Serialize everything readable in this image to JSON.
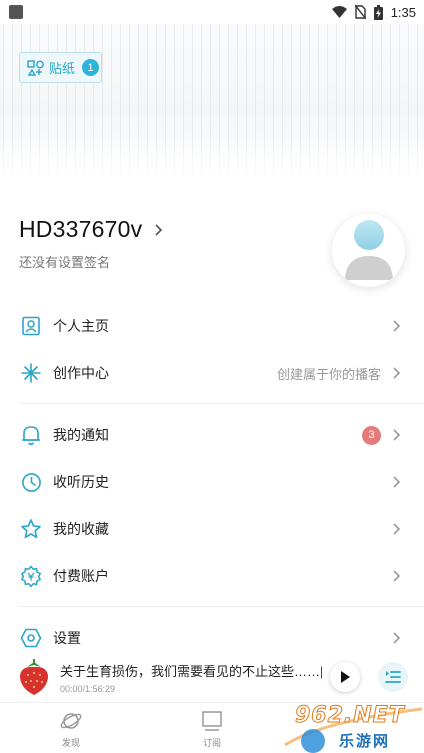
{
  "status_bar": {
    "time": "1:35"
  },
  "sticker": {
    "label": "贴纸",
    "count": "1"
  },
  "user": {
    "name": "HD337670v",
    "signature": "还没有设置签名"
  },
  "menu": {
    "profile": {
      "label": "个人主页"
    },
    "creator": {
      "label": "创作中心",
      "hint": "创建属于你的播客"
    },
    "notifications": {
      "label": "我的通知",
      "badge": "3"
    },
    "history": {
      "label": "收听历史"
    },
    "favorites": {
      "label": "我的收藏"
    },
    "paid": {
      "label": "付费账户"
    },
    "settings": {
      "label": "设置"
    }
  },
  "player": {
    "title": "关于生育损伤，我们需要看见的不止这些……|...",
    "time": "00:00/1:56:29"
  },
  "tabs": [
    {
      "label": "发现"
    },
    {
      "label": "订阅"
    }
  ],
  "watermark": {
    "main": "962.NET",
    "sub": "乐游网"
  },
  "colors": {
    "accent": "#2aa5c9",
    "badge": "#e37b7b",
    "text": "#222222",
    "hint": "#999999"
  }
}
